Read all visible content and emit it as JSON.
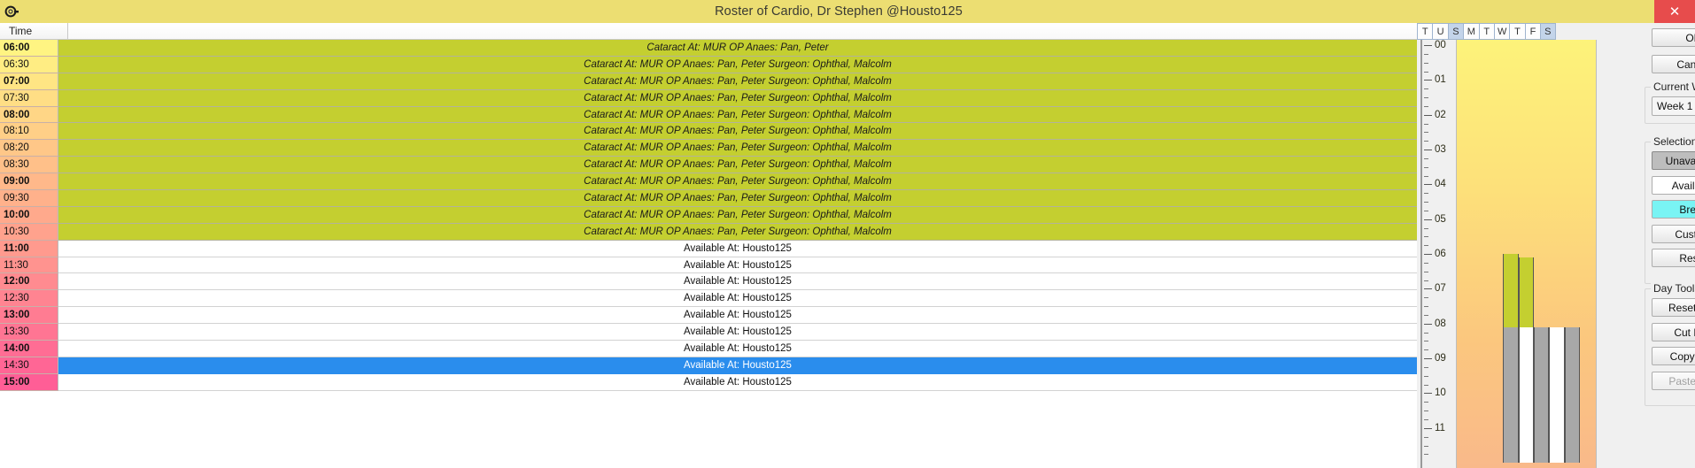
{
  "window": {
    "title": "Roster of Cardio, Dr Stephen @Housto125",
    "icon": "roster-app-icon",
    "close_label": "✕"
  },
  "grid": {
    "time_column_header": "Time",
    "rows": [
      {
        "time": "06:00",
        "hour": true,
        "state": "busy",
        "text": "Cataract  At: MUR OP  Anaes: Pan, Peter"
      },
      {
        "time": "06:30",
        "hour": false,
        "state": "busy",
        "text": "Cataract  At: MUR OP  Anaes: Pan, Peter  Surgeon: Ophthal, Malcolm"
      },
      {
        "time": "07:00",
        "hour": true,
        "state": "busy",
        "text": "Cataract  At: MUR OP  Anaes: Pan, Peter  Surgeon: Ophthal, Malcolm"
      },
      {
        "time": "07:30",
        "hour": false,
        "state": "busy",
        "text": "Cataract  At: MUR OP  Anaes: Pan, Peter  Surgeon: Ophthal, Malcolm"
      },
      {
        "time": "08:00",
        "hour": true,
        "state": "busy",
        "text": "Cataract  At: MUR OP  Anaes: Pan, Peter  Surgeon: Ophthal, Malcolm"
      },
      {
        "time": "08:10",
        "hour": false,
        "state": "busy",
        "text": "Cataract  At: MUR OP  Anaes: Pan, Peter  Surgeon: Ophthal, Malcolm"
      },
      {
        "time": "08:20",
        "hour": false,
        "state": "busy",
        "text": "Cataract  At: MUR OP  Anaes: Pan, Peter  Surgeon: Ophthal, Malcolm"
      },
      {
        "time": "08:30",
        "hour": false,
        "state": "busy",
        "text": "Cataract  At: MUR OP  Anaes: Pan, Peter  Surgeon: Ophthal, Malcolm"
      },
      {
        "time": "09:00",
        "hour": true,
        "state": "busy",
        "text": "Cataract  At: MUR OP  Anaes: Pan, Peter  Surgeon: Ophthal, Malcolm"
      },
      {
        "time": "09:30",
        "hour": false,
        "state": "busy",
        "text": "Cataract  At: MUR OP  Anaes: Pan, Peter  Surgeon: Ophthal, Malcolm"
      },
      {
        "time": "10:00",
        "hour": true,
        "state": "busy",
        "text": "Cataract  At: MUR OP  Anaes: Pan, Peter  Surgeon: Ophthal, Malcolm"
      },
      {
        "time": "10:30",
        "hour": false,
        "state": "busy",
        "text": "Cataract  At: MUR OP  Anaes: Pan, Peter  Surgeon: Ophthal, Malcolm"
      },
      {
        "time": "11:00",
        "hour": true,
        "state": "free",
        "text": "Available  At: Housto125"
      },
      {
        "time": "11:30",
        "hour": false,
        "state": "free",
        "text": "Available  At: Housto125"
      },
      {
        "time": "12:00",
        "hour": true,
        "state": "free",
        "text": "Available  At: Housto125"
      },
      {
        "time": "12:30",
        "hour": false,
        "state": "free",
        "text": "Available  At: Housto125"
      },
      {
        "time": "13:00",
        "hour": true,
        "state": "free",
        "text": "Available  At: Housto125"
      },
      {
        "time": "13:30",
        "hour": false,
        "state": "free",
        "text": "Available  At: Housto125"
      },
      {
        "time": "14:00",
        "hour": true,
        "state": "free",
        "text": "Available  At: Housto125"
      },
      {
        "time": "14:30",
        "hour": false,
        "state": "selected",
        "text": "Available  At: Housto125"
      },
      {
        "time": "15:00",
        "hour": true,
        "state": "free",
        "text": "Available  At: Housto125"
      }
    ]
  },
  "week_overview": {
    "day_headers": [
      "T",
      "U",
      "S",
      "M",
      "T",
      "W",
      "T",
      "F",
      "S"
    ],
    "weekend_indices": [
      2,
      8
    ],
    "hour_labels": [
      "00",
      "01",
      "02",
      "03",
      "04",
      "05",
      "06",
      "07",
      "08",
      "09",
      "10",
      "11"
    ],
    "columns": [
      {
        "day": "T",
        "segments": []
      },
      {
        "day": "U",
        "segments": []
      },
      {
        "day": "S",
        "segments": []
      },
      {
        "day": "M",
        "segments": [
          {
            "start_hour": 6.0,
            "end_hour": 8.1,
            "color": "#c4cf30"
          },
          {
            "start_hour": 8.1,
            "end_hour": 12.0,
            "color": "#a8a8a8"
          }
        ]
      },
      {
        "day": "T",
        "segments": [
          {
            "start_hour": 6.1,
            "end_hour": 8.1,
            "color": "#c4cf30"
          },
          {
            "start_hour": 8.1,
            "end_hour": 12.0,
            "color": "#ffffff"
          }
        ]
      },
      {
        "day": "W",
        "segments": [
          {
            "start_hour": 8.1,
            "end_hour": 12.0,
            "color": "#a8a8a8"
          }
        ]
      },
      {
        "day": "T",
        "segments": [
          {
            "start_hour": 8.1,
            "end_hour": 12.0,
            "color": "#ffffff"
          }
        ]
      },
      {
        "day": "F",
        "segments": [
          {
            "start_hour": 8.1,
            "end_hour": 12.0,
            "color": "#a8a8a8"
          }
        ]
      },
      {
        "day": "S",
        "segments": []
      }
    ]
  },
  "panel": {
    "ok_label": "OK",
    "cancel_label": "Cancel",
    "current_week": {
      "group_label": "Current Week",
      "value": "Week 1",
      "chevron": "⌄"
    },
    "selection_tools": {
      "group_label": "Selection Tools",
      "buttons": [
        {
          "label": "Unavailable",
          "style": "pressed"
        },
        {
          "label": "Available",
          "style": "white"
        },
        {
          "label": "Break",
          "style": "cyan"
        },
        {
          "label": "Custom",
          "style": "normal"
        },
        {
          "label": "Reset",
          "style": "normal"
        }
      ]
    },
    "day_tools": {
      "group_label": "Day Tools",
      "buttons": [
        {
          "label": "Reset Day",
          "style": "normal"
        },
        {
          "label": "Cut Day",
          "style": "normal"
        },
        {
          "label": "Copy Day",
          "style": "normal"
        },
        {
          "label": "Paste Day",
          "style": "disabled"
        }
      ]
    }
  },
  "colors": {
    "title_bar": "#ecde72",
    "busy": "#c4cf30",
    "selected_row": "#2a8ded",
    "close": "#e74c4c",
    "break": "#79f4f4"
  }
}
